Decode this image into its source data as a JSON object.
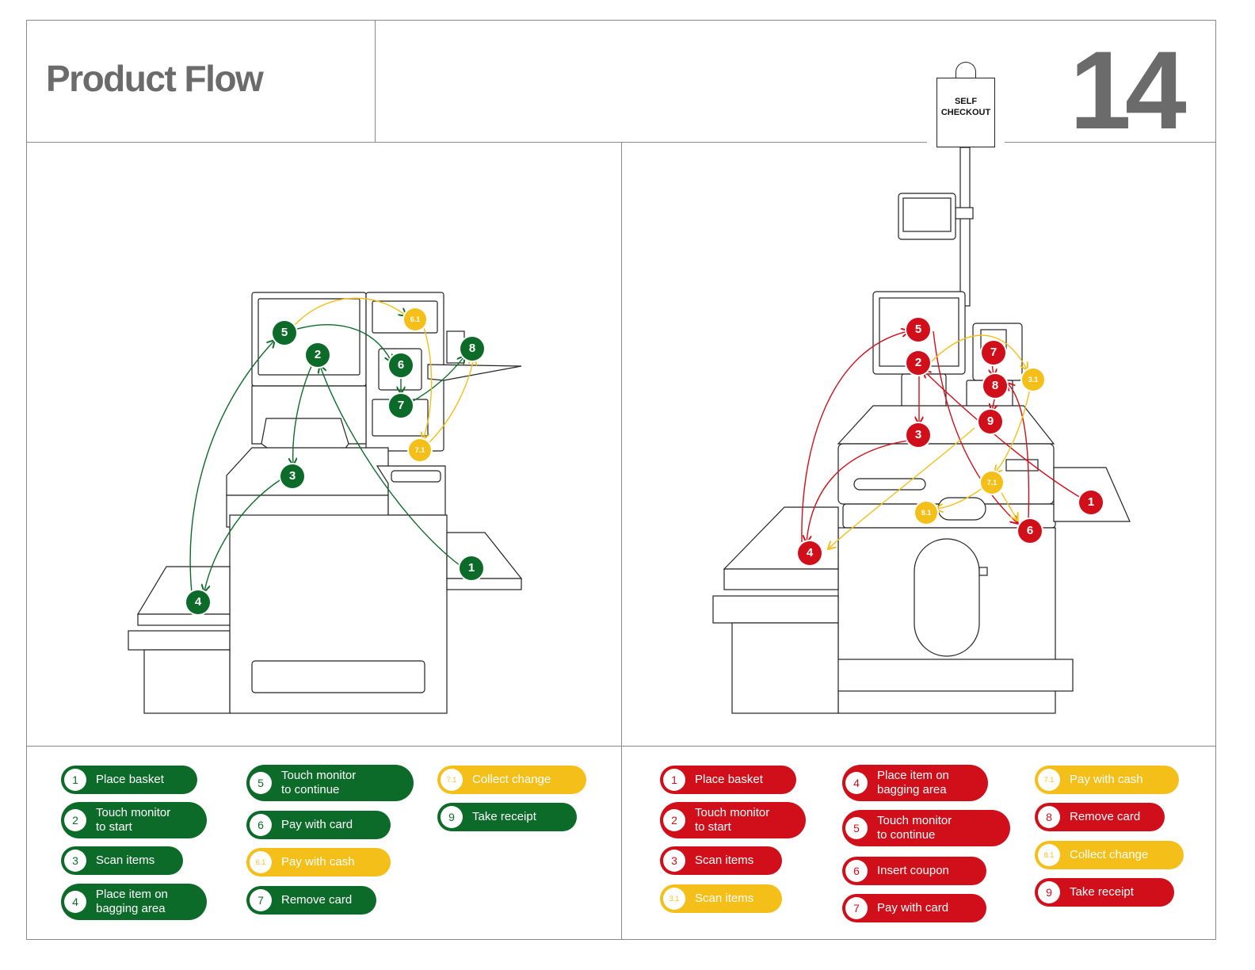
{
  "header": {
    "title": "Product Flow",
    "page_number": "14"
  },
  "sign": {
    "line1": "SELF",
    "line2": "CHECKOUT"
  },
  "colors": {
    "green": "#0d6b2a",
    "red": "#d10f1a",
    "yellow": "#f4bf18",
    "frame": "#8a8a8a",
    "title_gray": "#6b6b6b"
  },
  "left_diagram": {
    "markers": [
      {
        "label": "1",
        "color": "green"
      },
      {
        "label": "2",
        "color": "green"
      },
      {
        "label": "3",
        "color": "green"
      },
      {
        "label": "4",
        "color": "green"
      },
      {
        "label": "5",
        "color": "green"
      },
      {
        "label": "6",
        "color": "green"
      },
      {
        "label": "7",
        "color": "green"
      },
      {
        "label": "8",
        "color": "green"
      },
      {
        "label": "6.1",
        "color": "yellow"
      },
      {
        "label": "7.1",
        "color": "yellow"
      }
    ]
  },
  "right_diagram": {
    "markers": [
      {
        "label": "1",
        "color": "red"
      },
      {
        "label": "2",
        "color": "red"
      },
      {
        "label": "3",
        "color": "red"
      },
      {
        "label": "4",
        "color": "red"
      },
      {
        "label": "5",
        "color": "red"
      },
      {
        "label": "6",
        "color": "red"
      },
      {
        "label": "7",
        "color": "red"
      },
      {
        "label": "8",
        "color": "red"
      },
      {
        "label": "9",
        "color": "red"
      },
      {
        "label": "3.1",
        "color": "yellow"
      },
      {
        "label": "7.1",
        "color": "yellow"
      },
      {
        "label": "8.1",
        "color": "yellow"
      }
    ]
  },
  "left_legend": [
    {
      "num": "1",
      "text": "Place basket",
      "color": "green"
    },
    {
      "num": "2",
      "text": "Touch monitor\nto start",
      "color": "green"
    },
    {
      "num": "3",
      "text": "Scan items",
      "color": "green"
    },
    {
      "num": "4",
      "text": "Place item on\nbagging area",
      "color": "green"
    },
    {
      "num": "5",
      "text": "Touch monitor\nto continue",
      "color": "green"
    },
    {
      "num": "6",
      "text": "Pay with card",
      "color": "green"
    },
    {
      "num": "6.1",
      "text": "Pay with cash",
      "color": "yellow"
    },
    {
      "num": "7",
      "text": "Remove card",
      "color": "green"
    },
    {
      "num": "7.1",
      "text": "Collect change",
      "color": "yellow"
    },
    {
      "num": "9",
      "text": "Take receipt",
      "color": "green"
    }
  ],
  "right_legend": [
    {
      "num": "1",
      "text": "Place basket",
      "color": "red"
    },
    {
      "num": "2",
      "text": "Touch monitor\nto start",
      "color": "red"
    },
    {
      "num": "3",
      "text": "Scan items",
      "color": "red"
    },
    {
      "num": "3.1",
      "text": "Scan items",
      "color": "yellow"
    },
    {
      "num": "4",
      "text": "Place item on\nbagging area",
      "color": "red"
    },
    {
      "num": "5",
      "text": "Touch monitor\nto continue",
      "color": "red"
    },
    {
      "num": "6",
      "text": "Insert coupon",
      "color": "red"
    },
    {
      "num": "7",
      "text": "Pay with card",
      "color": "red"
    },
    {
      "num": "7.1",
      "text": "Pay with cash",
      "color": "yellow"
    },
    {
      "num": "8",
      "text": "Remove card",
      "color": "red"
    },
    {
      "num": "8.1",
      "text": "Collect change",
      "color": "yellow"
    },
    {
      "num": "9",
      "text": "Take receipt",
      "color": "red"
    }
  ]
}
